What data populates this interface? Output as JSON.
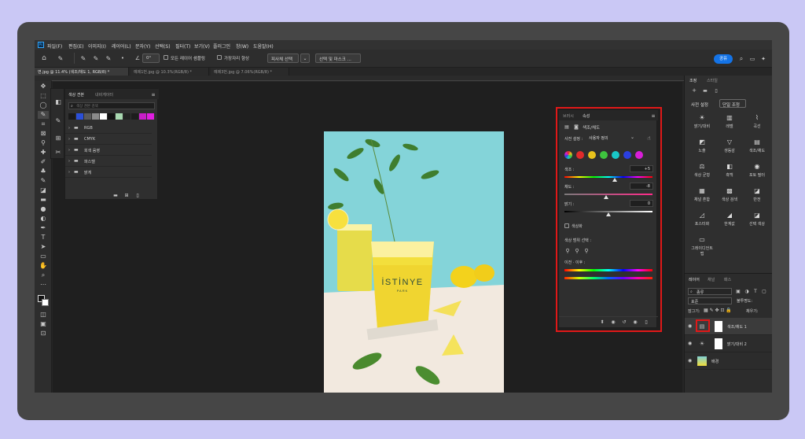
{
  "app": {
    "menu": [
      "파일(F)",
      "편집(E)",
      "이미지(I)",
      "레이어(L)",
      "문자(Y)",
      "선택(S)",
      "필터(T)",
      "보기(V)",
      "플러그인",
      "창(W)",
      "도움말(H)"
    ],
    "share_label": "공유"
  },
  "options_bar": {
    "angle": "0°",
    "sample_all_layers": "모든 레이어 샘플링",
    "enhance_edge": "가장자리 향상",
    "object_select": "피사체 선택",
    "select_mask": "선택 및 마스크 ..."
  },
  "tabs": [
    {
      "label": "변.jpg @ 11.4% (색조/채도 1, RGB/8) *",
      "active": true
    },
    {
      "label": "예제1번.jpg @ 10.3%(RGB/8) *",
      "active": false
    },
    {
      "label": "예제3번.jpg @ 7.06%(RGB/8) *",
      "active": false
    }
  ],
  "swatches_panel": {
    "tabs": [
      "색상 견본",
      "내비게이터"
    ],
    "search_placeholder": "색상 견본 검색",
    "swatch_colors": [
      "#1a1a1a",
      "#2b4fd8",
      "#5a5a5a",
      "#8a8a8a",
      "#ffffff",
      "#121212",
      "#a8d8b0",
      "#222222",
      "#1d1d1d",
      "#c81ec8",
      "#e01ee0"
    ],
    "groups": [
      "RGB",
      "CMYK",
      "회색 음영",
      "파스텔",
      "밝게"
    ]
  },
  "properties": {
    "tabs": [
      "브러시",
      "속성"
    ],
    "layer_type": "색조/채도",
    "preset_label": "사전 설정 :",
    "preset_value": "사용자 정의",
    "colors": [
      "#e02b2b",
      "#e8c21c",
      "#3ec43e",
      "#19c8c8",
      "#2b3fe0",
      "#d81ed8"
    ],
    "hue_label": "색조 :",
    "hue_value": "+5",
    "hue_level_pct": 57,
    "sat_label": "채도 :",
    "sat_value": "-8",
    "sat_level_pct": 47,
    "light_label": "밝기 :",
    "light_value": "0",
    "light_level_pct": 50,
    "colorize_label": "색상화",
    "range_label": "색상 범위 선택 :",
    "before_after_label": "이전 · 이후 :"
  },
  "adjustments": {
    "tabs": [
      "조정",
      "스타일"
    ],
    "section_labels": [
      "사전 설정",
      "단일 조정"
    ],
    "items": [
      {
        "icon": "☀",
        "label": "밝기/대비"
      },
      {
        "icon": "▥",
        "label": "레벨"
      },
      {
        "icon": "⌇",
        "label": "곡선"
      },
      {
        "icon": "◩",
        "label": "노출"
      },
      {
        "icon": "▽",
        "label": "생동감"
      },
      {
        "icon": "▤",
        "label": "색조/채도"
      },
      {
        "icon": "⚖",
        "label": "색상 균형"
      },
      {
        "icon": "◧",
        "label": "흑백"
      },
      {
        "icon": "◉",
        "label": "포토 필터"
      },
      {
        "icon": "▦",
        "label": "채널 혼합"
      },
      {
        "icon": "▩",
        "label": "색상 검색"
      },
      {
        "icon": "◪",
        "label": "반전"
      },
      {
        "icon": "◿",
        "label": "포스터화"
      },
      {
        "icon": "◢",
        "label": "한계값"
      },
      {
        "icon": "◪",
        "label": "선택 색상"
      },
      {
        "icon": "▭",
        "label": "그레이디언트 맵"
      }
    ]
  },
  "layers": {
    "tabs": [
      "레이어",
      "채널",
      "패스"
    ],
    "filter_label": "종류",
    "blend_mode": "표준",
    "opacity_label": "불투명도:",
    "lock_label": "잠그기:",
    "fill_label": "채우기:",
    "items": [
      {
        "name": "색조/채도 1",
        "icon": "hue-sat-icon"
      },
      {
        "name": "밝기/대비 2",
        "icon": "brightness-icon"
      },
      {
        "name": "배경",
        "icon": "image-thumb"
      }
    ]
  },
  "colors": {
    "accent": "#1473e6",
    "highlight": "#e01818"
  },
  "photo": {
    "cup_text_1": "İSTİNYE",
    "cup_text_2": "PARK"
  }
}
